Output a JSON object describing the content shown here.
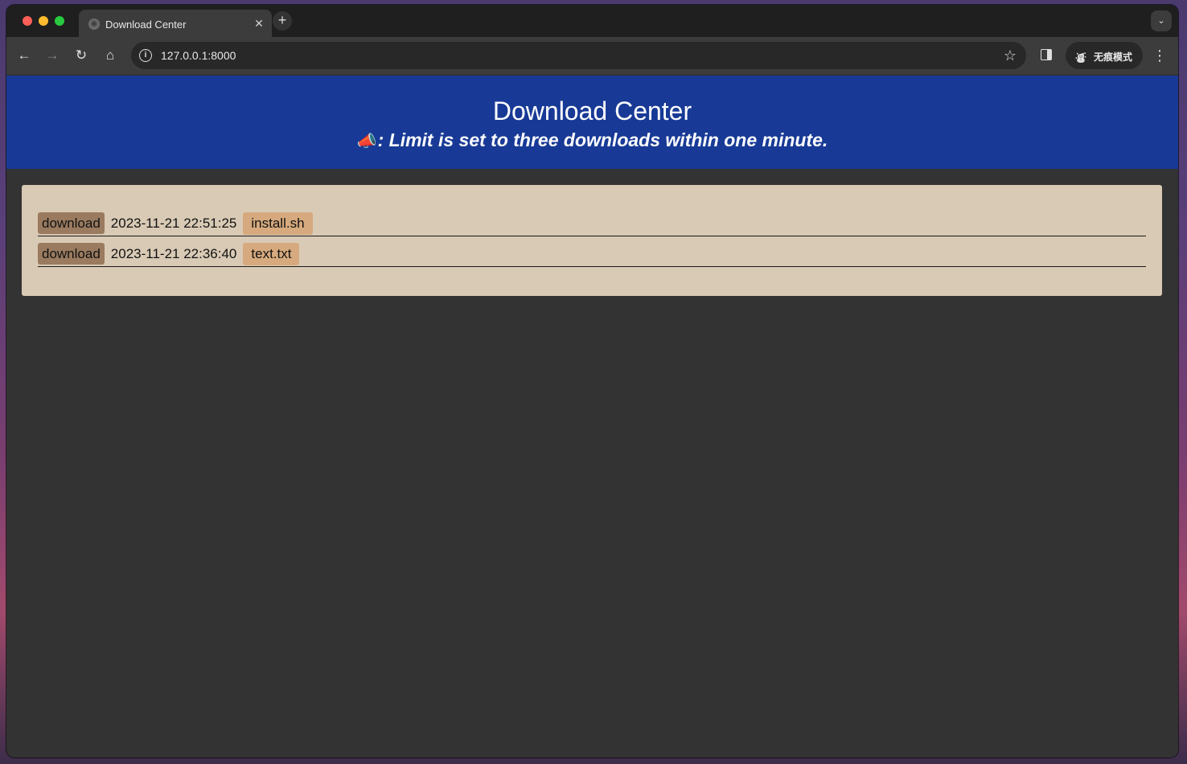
{
  "browser": {
    "tab": {
      "title": "Download Center",
      "close_glyph": "✕"
    },
    "new_tab_glyph": "+",
    "tab_search_glyph": "⌄",
    "nav": {
      "back_glyph": "←",
      "forward_glyph": "→",
      "reload_glyph": "↻",
      "home_glyph": "⌂"
    },
    "omnibox": {
      "info_glyph": "i",
      "url": "127.0.0.1:8000",
      "bookmark_glyph": "☆"
    },
    "incognito": {
      "icon_glyph": "⛇",
      "label": "无痕模式"
    },
    "menu_glyph": "⋮"
  },
  "page": {
    "title": "Download Center",
    "notice_icon": "📣",
    "notice_text": ": Limit is set to three downloads within one minute.",
    "downloads": [
      {
        "button_label": "download",
        "timestamp": "2023-11-21 22:51:25",
        "filename": "install.sh"
      },
      {
        "button_label": "download",
        "timestamp": "2023-11-21 22:36:40",
        "filename": "text.txt"
      }
    ]
  },
  "colors": {
    "header_bg": "#183a96",
    "page_bg": "#333333",
    "panel_bg": "#d9cab5",
    "download_button_bg": "#9a7b60",
    "filename_badge_bg": "#d6aa7e"
  }
}
